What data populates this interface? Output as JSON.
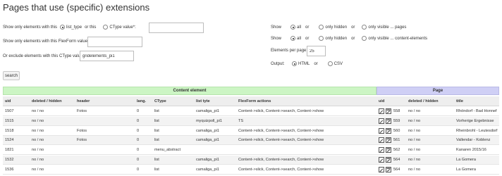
{
  "title": "Pages that use (specific) extensions",
  "filters": {
    "show_only_label": "Show only elements with this",
    "list_type_label": "list_type",
    "or_this_label": "or this",
    "ctype_value_label": "CType value*:",
    "ctype_value_input": "",
    "flexform_label": "Show only elements with this FlexForm value**:",
    "flexform_input": "",
    "exclude_label": "Or exclude elements with this CType value:",
    "exclude_input": "gridelements_pi1"
  },
  "show_pages": {
    "label": "Show",
    "all": "all",
    "or1": "or",
    "only_hidden": "only hidden",
    "or2": "or",
    "only_visible": "only visible ... pages"
  },
  "show_ce": {
    "label": "Show",
    "all": "all",
    "or1": "or",
    "only_hidden": "only hidden",
    "or2": "or",
    "only_visible": "only visible ... content-elements"
  },
  "per_page": {
    "label": "Elements per page:",
    "value": "25"
  },
  "output": {
    "label": "Output:",
    "html": "HTML",
    "or": "or",
    "csv": "CSV"
  },
  "search_button": "search",
  "table": {
    "group_ce": "Content element",
    "group_page": "Page",
    "headers": {
      "uid": "uid",
      "deleted": "deleted / hidden",
      "header": "header",
      "lang": "lang.",
      "ctype": "CType",
      "list_type": "list tyte",
      "flexform": "FlexForm actions",
      "page_uid": "uid",
      "page_deleted": "deleted / hidden",
      "page_title": "title"
    },
    "rows": [
      {
        "uid": "1507",
        "deleted": "no / no",
        "header": "Fotos",
        "lang": "0",
        "ctype": "list",
        "list_type": "camaliga_pi1",
        "flexform": "Content->slick, Content->search, Content->show",
        "page_uid": "558",
        "page_deleted": "no / no",
        "page_title": "Rhöndorf - Bad Honnef"
      },
      {
        "uid": "1515",
        "deleted": "no / no",
        "header": "",
        "lang": "0",
        "ctype": "list",
        "list_type": "myquizpoll_pi1",
        "flexform": "TS",
        "page_uid": "559",
        "page_deleted": "no / no",
        "page_title": "Vorherige Ergebnisse"
      },
      {
        "uid": "1518",
        "deleted": "no / no",
        "header": "Fotos",
        "lang": "0",
        "ctype": "list",
        "list_type": "camaliga_pi1",
        "flexform": "Content->slick, Content->search, Content->show",
        "page_uid": "560",
        "page_deleted": "no / no",
        "page_title": "Rheinbrohl - Leutesdorf"
      },
      {
        "uid": "1524",
        "deleted": "no / no",
        "header": "Fotos",
        "lang": "0",
        "ctype": "list",
        "list_type": "camaliga_pi1",
        "flexform": "Content->slick, Content->search, Content->show",
        "page_uid": "561",
        "page_deleted": "no / no",
        "page_title": "Vallendar - Koblenz"
      },
      {
        "uid": "1821",
        "deleted": "no / no",
        "header": "",
        "lang": "0",
        "ctype": "menu_abstract",
        "list_type": "",
        "flexform": "",
        "page_uid": "562",
        "page_deleted": "no / no",
        "page_title": "Kanaren 2015/16"
      },
      {
        "uid": "1532",
        "deleted": "no / no",
        "header": "",
        "lang": "0",
        "ctype": "list",
        "list_type": "camaliga_pi1",
        "flexform": "Content->slick, Content->search, Content->show",
        "page_uid": "564",
        "page_deleted": "no / no",
        "page_title": "La Gomera"
      },
      {
        "uid": "1536",
        "deleted": "no / no",
        "header": "",
        "lang": "0",
        "ctype": "list",
        "list_type": "camaliga_pi1",
        "flexform": "Content->slick, Content->search, Content->show",
        "page_uid": "564",
        "page_deleted": "no / no",
        "page_title": "La Gomera"
      }
    ]
  },
  "icons": {
    "edit": "edit-pencil-icon",
    "view": "view-page-icon"
  }
}
